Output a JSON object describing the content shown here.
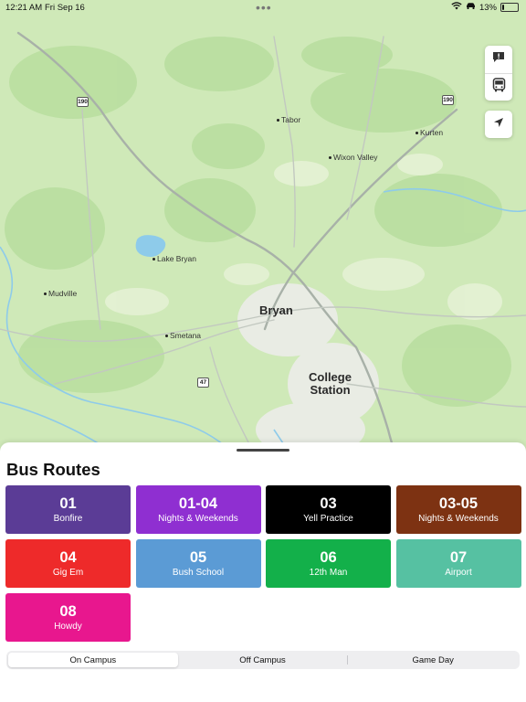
{
  "status_bar": {
    "time": "12:21 AM",
    "date": "Fri Sep 16",
    "battery": "13%",
    "battery_level": 0.13
  },
  "map": {
    "places": [
      {
        "name": "Tabor",
        "kind": "town"
      },
      {
        "name": "Kurten",
        "kind": "town"
      },
      {
        "name": "Wixon Valley",
        "kind": "town"
      },
      {
        "name": "Lake Bryan",
        "kind": "town"
      },
      {
        "name": "Mudville",
        "kind": "town"
      },
      {
        "name": "Smetana",
        "kind": "town"
      }
    ],
    "cities": {
      "bryan": "Bryan",
      "college_station_line1": "College",
      "college_station_line2": "Station"
    },
    "highway_shields": {
      "a": "190",
      "b": "190",
      "c": "47"
    },
    "buttons": {
      "report_icon": "exclamation-bubble-icon",
      "bus_icon": "bus-icon",
      "location_icon": "location-arrow-icon"
    }
  },
  "sheet": {
    "title": "Bus Routes",
    "routes": [
      {
        "number": "01",
        "name": "Bonfire",
        "color": "#5b3c96"
      },
      {
        "number": "01-04",
        "name": "Nights & Weekends",
        "color": "#8f2fd1"
      },
      {
        "number": "03",
        "name": "Yell Practice",
        "color": "#000000"
      },
      {
        "number": "03-05",
        "name": "Nights & Weekends",
        "color": "#7d3212"
      },
      {
        "number": "04",
        "name": "Gig Em",
        "color": "#ee2a2a"
      },
      {
        "number": "05",
        "name": "Bush School",
        "color": "#5b9bd5"
      },
      {
        "number": "06",
        "name": "12th Man",
        "color": "#13b04a"
      },
      {
        "number": "07",
        "name": "Airport",
        "color": "#56c1a2"
      },
      {
        "number": "08",
        "name": "Howdy",
        "color": "#e8178e"
      }
    ],
    "segments": {
      "on_campus": "On Campus",
      "off_campus": "Off Campus",
      "game_day": "Game Day",
      "selected": "On Campus"
    }
  }
}
